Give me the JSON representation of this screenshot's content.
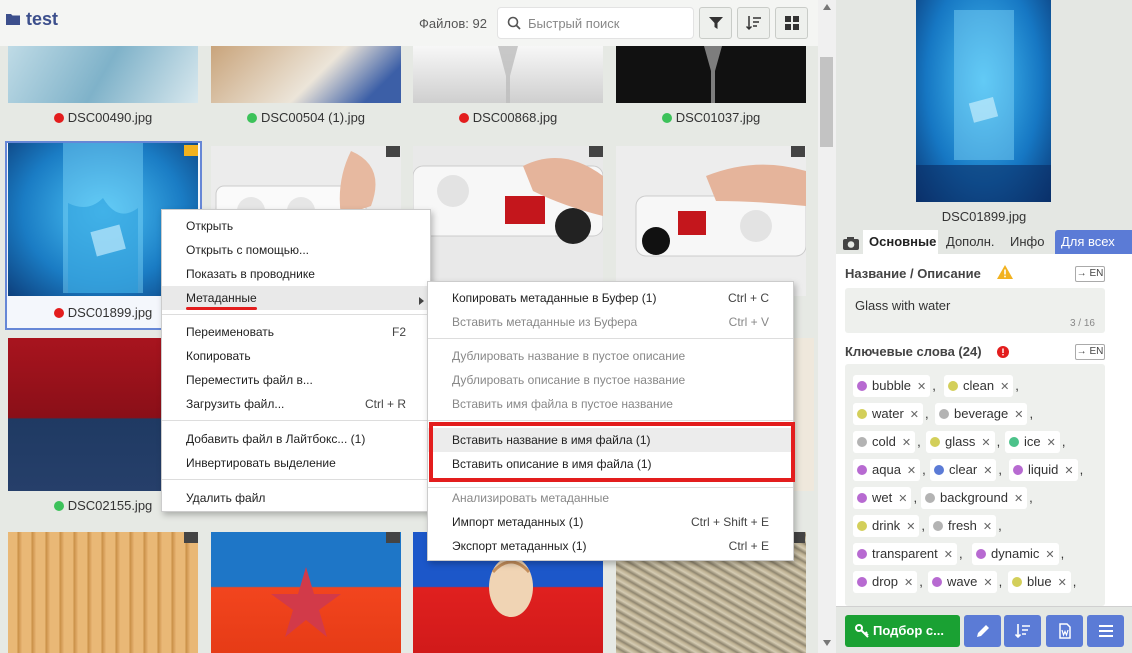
{
  "header": {
    "folder_name": "test",
    "files_count": "Файлов: 92",
    "search_placeholder": "Быстрый поиск"
  },
  "grid": {
    "row1_names": [
      "DSC00490.jpg",
      "DSC00504 (1).jpg",
      "DSC00868.jpg",
      "DSC01037.jpg"
    ],
    "row1_dots": [
      "#e31d1d",
      "#3cc25a",
      "#e31d1d",
      "#3cc25a"
    ],
    "selected_name": "DSC01899.jpg",
    "selected_dot": "#e31d1d",
    "row3_name": "DSC02155.jpg",
    "row3_dot": "#3cc25a"
  },
  "context_menu": {
    "items": [
      "Открыть",
      "Открыть с помощью...",
      "Показать в проводнике",
      "Метаданные",
      "Переименовать",
      "Копировать",
      "Переместить файл в...",
      "Загрузить файл...",
      "Добавить файл в Лайтбокс... (1)",
      "Инвертировать выделение",
      "Удалить файл"
    ],
    "shortcuts": {
      "rename": "F2",
      "upload": "Ctrl + R"
    }
  },
  "submenu": {
    "items": [
      "Копировать метаданные в Буфер (1)",
      "Вставить метаданные из Буфера",
      "Дублировать название в пустое описание",
      "Дублировать описание в пустое название",
      "Вставить имя файла в пустое название",
      "Вставить название в имя файла (1)",
      "Вставить описание в имя файла (1)",
      "Анализировать метаданные",
      "Импорт метаданных (1)",
      "Экспорт метаданных (1)"
    ],
    "shortcuts": {
      "copy": "Ctrl + C",
      "paste": "Ctrl + V",
      "import": "Ctrl + Shift + E",
      "export": "Ctrl + E"
    }
  },
  "panel": {
    "preview_name": "DSC01899.jpg",
    "tabs": [
      "Основные",
      "Дополн.",
      "Инфо",
      "Для всех"
    ],
    "title_label": "Название / Описание",
    "en_label": "EN",
    "title_value": "Glass with water",
    "title_counter": "3 / 16",
    "keywords_label": "Ключевые слова (24)",
    "keywords": [
      {
        "word": "bubble",
        "color": "#b76ad1"
      },
      {
        "word": "clean",
        "color": "#d3cf5a"
      },
      {
        "word": "water",
        "color": "#d3cf5a"
      },
      {
        "word": "beverage",
        "color": "#b3b3b3"
      },
      {
        "word": "cold",
        "color": "#b3b3b3"
      },
      {
        "word": "glass",
        "color": "#d3cf5a"
      },
      {
        "word": "ice",
        "color": "#4cc28a"
      },
      {
        "word": "aqua",
        "color": "#b76ad1"
      },
      {
        "word": "clear",
        "color": "#5b7bd6"
      },
      {
        "word": "liquid",
        "color": "#b76ad1"
      },
      {
        "word": "wet",
        "color": "#b76ad1"
      },
      {
        "word": "background",
        "color": "#b3b3b3"
      },
      {
        "word": "drink",
        "color": "#d3cf5a"
      },
      {
        "word": "fresh",
        "color": "#b3b3b3"
      },
      {
        "word": "transparent",
        "color": "#b76ad1"
      },
      {
        "word": "dynamic",
        "color": "#b76ad1"
      },
      {
        "word": "drop",
        "color": "#b76ad1"
      },
      {
        "word": "wave",
        "color": "#b76ad1"
      },
      {
        "word": "blue",
        "color": "#d3cf5a"
      }
    ],
    "suggest_label": "Подбор с..."
  }
}
